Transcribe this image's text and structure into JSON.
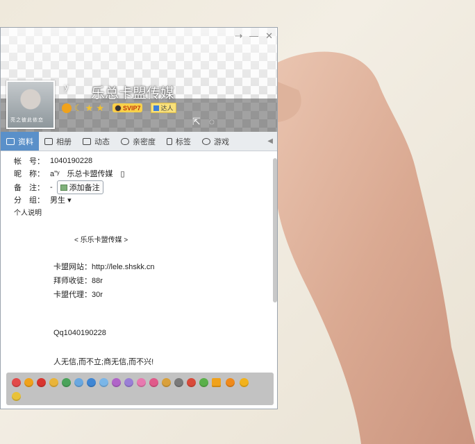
{
  "window": {
    "controls": [
      "⇢",
      "—",
      "✕"
    ]
  },
  "profile": {
    "avatar_caption": "亮之彼此依恋",
    "nick_symbol": "ʸ",
    "nickname": "乐总卡盟传媒",
    "svip_label": "SVIP7",
    "daren_label": "达人",
    "actions": [
      "⇱",
      "◌"
    ]
  },
  "tabs": [
    {
      "label": "资料",
      "icon": "id-card-icon",
      "active": true
    },
    {
      "label": "相册",
      "icon": "photo-icon"
    },
    {
      "label": "动态",
      "icon": "list-icon"
    },
    {
      "label": "亲密度",
      "icon": "heart-icon"
    },
    {
      "label": "标签",
      "icon": "bookmark-icon"
    },
    {
      "label": "游戏",
      "icon": "game-icon"
    }
  ],
  "tab_more": "◀",
  "fields": {
    "account_label": "帐　号：",
    "account_value": "1040190228",
    "nick_label": "昵　称：",
    "nick_value": "aʺʸ　乐总卡盟传媒　▯",
    "note_label": "备　注：",
    "note_value": "-",
    "add_note": "添加备注",
    "group_label": "分　组：",
    "group_value": "男生",
    "group_arrow": "▾",
    "bio_label": "个人说明"
  },
  "bio": {
    "title": "< 乐乐卡盟传媒 >",
    "line1": "卡盟网站：http://lele.shskk.cn",
    "line2": "拜师收徒：88r",
    "line3": "卡盟代理：30r",
    "line4": "Qq1040190228",
    "line5": "人无信,而不立;商无信,而不兴!"
  },
  "colors": {
    "tab_active": "#5a90c9",
    "nick_text": "#ffffff",
    "svip_bg": "#f8d24a"
  }
}
